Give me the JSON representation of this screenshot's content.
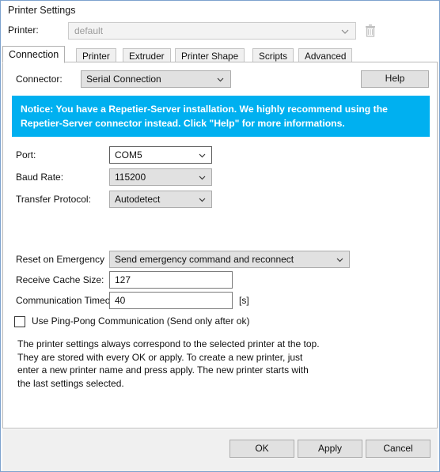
{
  "window": {
    "title": "Printer Settings",
    "accent_border": "#7da2ce",
    "notice_bg": "#00b0f0"
  },
  "printer_row": {
    "label": "Printer:",
    "value": "default",
    "placeholder": "default",
    "delete_icon": "trash-icon",
    "dropdown_icon": "chevron-down-icon"
  },
  "tabs": [
    {
      "label": "Connection",
      "active": true
    },
    {
      "label": "Printer",
      "active": false
    },
    {
      "label": "Extruder",
      "active": false
    },
    {
      "label": "Printer Shape",
      "active": false
    },
    {
      "label": "Scripts",
      "active": false
    },
    {
      "label": "Advanced",
      "active": false
    }
  ],
  "connection": {
    "connector_label": "Connector:",
    "connector_value": "Serial Connection",
    "help_label": "Help",
    "notice": "Notice: You have a Repetier-Server installation. We highly recommend using the Repetier-Server connector instead. Click \"Help\" for more informations.",
    "port_label": "Port:",
    "port_value": "COM5",
    "baud_label": "Baud Rate:",
    "baud_value": "115200",
    "protocol_label": "Transfer Protocol:",
    "protocol_value": "Autodetect",
    "reset_label": "Reset on Emergency",
    "reset_value": "Send emergency command and reconnect",
    "cache_label": "Receive Cache Size:",
    "cache_value": "127",
    "timeout_label": "Communication Timeout:",
    "timeout_value": "40",
    "timeout_unit": "[s]",
    "pingpong_label": "Use Ping-Pong Communication (Send only after ok)",
    "pingpong_checked": false,
    "info_text": "The printer settings always correspond to the selected printer at the top. They are stored with every OK or apply. To create a new printer, just enter a new printer name and press apply. The new printer starts with the last settings selected."
  },
  "footer": {
    "ok_label": "OK",
    "apply_label": "Apply",
    "cancel_label": "Cancel"
  }
}
